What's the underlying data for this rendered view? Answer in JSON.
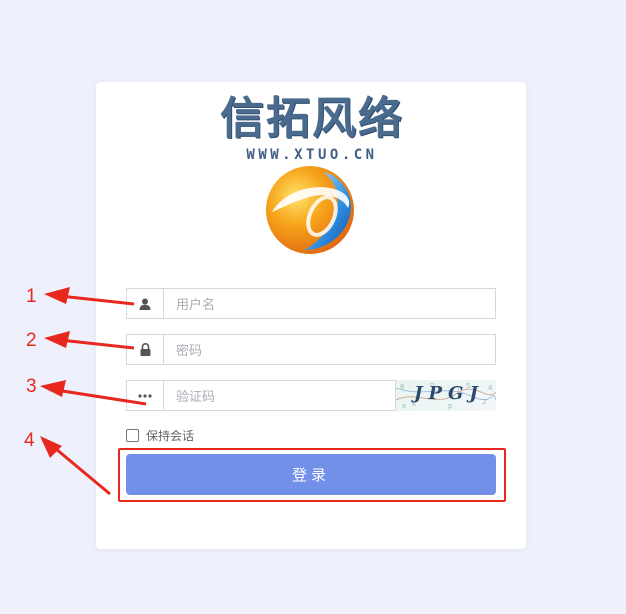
{
  "logo": {
    "title": "信拓风络",
    "url": "WWW.XTUO.CN"
  },
  "form": {
    "username_placeholder": "用户名",
    "password_placeholder": "密码",
    "captcha_placeholder": "验证码",
    "captcha_text": "JPGJ",
    "remember_label": "保持会话",
    "remember_checked": false,
    "login_label": "登录"
  },
  "annotations": [
    "1",
    "2",
    "3",
    "4"
  ],
  "colors": {
    "background": "#eef1fb",
    "button": "#7290e8",
    "annotation": "#e8271f"
  },
  "icons": [
    "user-icon",
    "lock-icon",
    "ellipsis-icon",
    "globe-logo-icon"
  ]
}
